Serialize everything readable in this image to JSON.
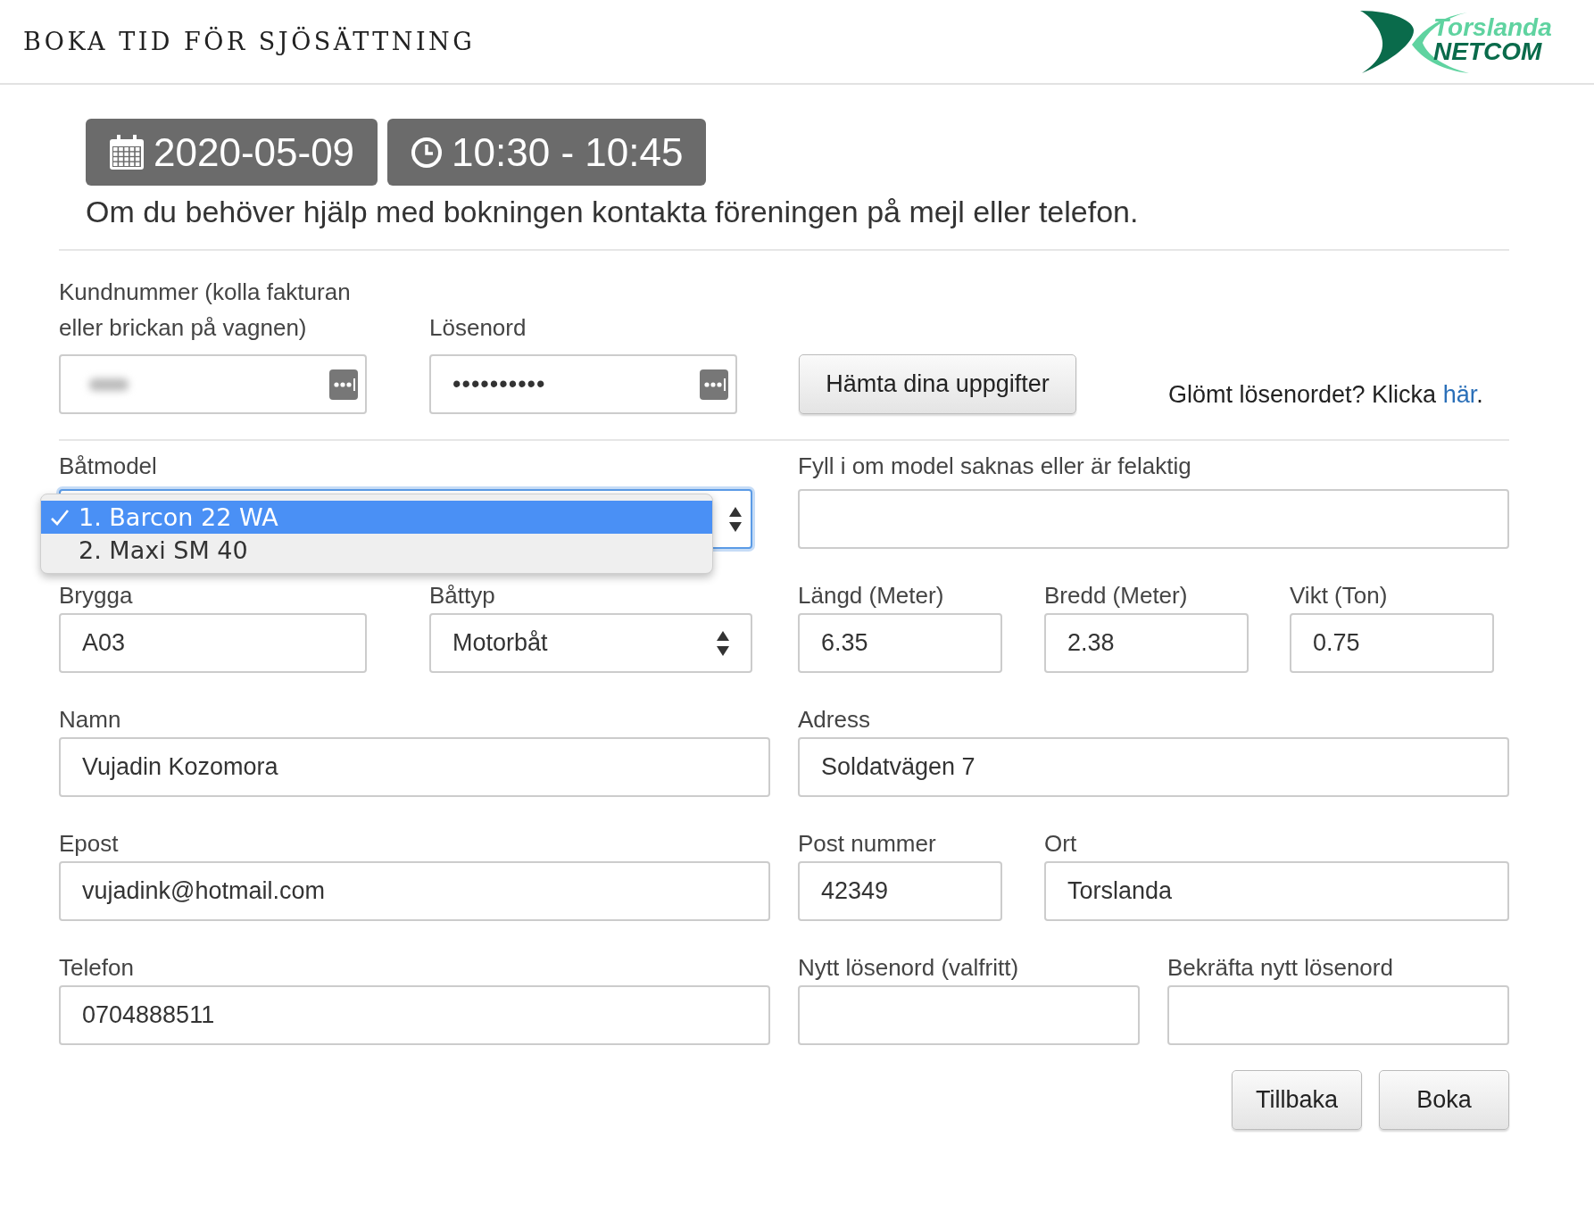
{
  "header": {
    "title": "BOKA TID FÖR SJÖSÄTTNING",
    "logo": {
      "line1": "Torslanda",
      "line2": "NETCOM"
    }
  },
  "booking": {
    "date": "2020-05-09",
    "time": "10:30 - 10:45",
    "help": "Om du behöver hjälp med bokningen kontakta föreningen på mejl eller telefon."
  },
  "login": {
    "customer_label": "Kundnummer (kolla fakturan eller brickan på vagnen)",
    "password_label": "Lösenord",
    "password_value": "••••••••••",
    "fetch_button": "Hämta dina uppgifter",
    "forgot_text": "Glömt lösenordet? Klicka",
    "forgot_link": "här",
    "forgot_suffix": "."
  },
  "boat_model": {
    "label": "Båtmodel",
    "expanded": true,
    "options": [
      {
        "label": "1. Barcon 22 WA",
        "selected": true
      },
      {
        "label": "2. Maxi SM 40",
        "selected": false
      }
    ]
  },
  "model_fix": {
    "label": "Fyll i om model saknas eller är felaktig"
  },
  "rows": [
    {
      "fields": [
        {
          "label": "Brygga",
          "value": "A03",
          "kind": "text"
        },
        {
          "label": "Båttyp",
          "value": "Motorbåt",
          "kind": "select"
        },
        {
          "label": "Längd (Meter)",
          "value": "6.35",
          "kind": "text"
        },
        {
          "label": "Bredd (Meter)",
          "value": "2.38",
          "kind": "text"
        },
        {
          "label": "Vikt (Ton)",
          "value": "0.75",
          "kind": "text"
        }
      ]
    },
    {
      "fields": [
        {
          "label": "Namn",
          "value": "Vujadin Kozomora",
          "kind": "text"
        },
        {
          "label": "Adress",
          "value": "Soldatvägen 7",
          "kind": "text"
        }
      ]
    },
    {
      "fields": [
        {
          "label": "Epost",
          "value": "vujadink@hotmail.com",
          "kind": "text"
        },
        {
          "label": "Post nummer",
          "value": "42349",
          "kind": "text"
        },
        {
          "label": "Ort",
          "value": "Torslanda",
          "kind": "text"
        }
      ]
    },
    {
      "fields": [
        {
          "label": "Telefon",
          "value": "0704888511",
          "kind": "text"
        },
        {
          "label": "Nytt lösenord (valfritt)",
          "kind": "text"
        },
        {
          "label": "Bekräfta nytt lösenord",
          "kind": "text"
        }
      ]
    }
  ],
  "buttons": [
    "Tillbaka",
    "Boka"
  ]
}
